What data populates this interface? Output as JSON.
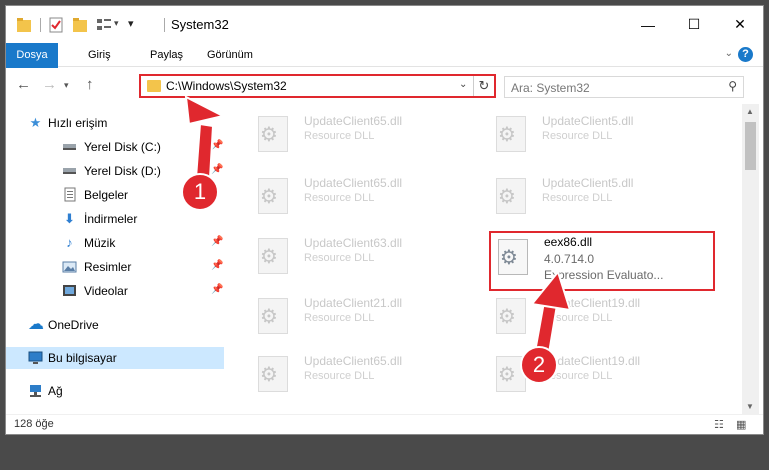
{
  "window": {
    "title": "System32",
    "controls": {
      "minimize": "—",
      "maximize": "☐",
      "close": "✕"
    }
  },
  "ribbon": {
    "tabs": [
      "Dosya",
      "Giriş",
      "Paylaş",
      "Görünüm"
    ],
    "help": "?"
  },
  "address_bar": {
    "path": "C:\\Windows\\System32",
    "search_placeholder": "Ara: System32"
  },
  "nav_pane": {
    "items": [
      {
        "label": "Hızlı erişim",
        "icon": "star-icon"
      },
      {
        "label": "Yerel Disk (C:)",
        "icon": "drive-icon"
      },
      {
        "label": "Yerel Disk (D:)",
        "icon": "drive-icon"
      },
      {
        "label": "Belgeler",
        "icon": "documents-icon"
      },
      {
        "label": "İndirmeler",
        "icon": "download-icon"
      },
      {
        "label": "Müzik",
        "icon": "music-icon"
      },
      {
        "label": "Resimler",
        "icon": "pictures-icon"
      },
      {
        "label": "Videolar",
        "icon": "videos-icon"
      },
      {
        "label": "OneDrive",
        "icon": "cloud-icon"
      },
      {
        "label": "Bu bilgisayar",
        "icon": "computer-icon"
      },
      {
        "label": "Ağ",
        "icon": "network-icon"
      }
    ]
  },
  "files": {
    "left_column": [
      {
        "name": "UpdateClient65.dll",
        "type": "Resource DLL"
      },
      {
        "name": "UpdateClient65.dll",
        "type": "Resource DLL"
      },
      {
        "name": "UpdateClient63.dll",
        "type": "Resource DLL"
      },
      {
        "name": "UpdateClient21.dll",
        "type": "Resource DLL"
      },
      {
        "name": "UpdateClient65.dll",
        "type": "Resource DLL"
      }
    ],
    "right_column": [
      {
        "name": "UpdateClient5.dll",
        "type": "Resource DLL"
      },
      {
        "name": "UpdateClient5.dll",
        "type": "Resource DLL"
      },
      {
        "name": "UpdateClient19.dll",
        "type": "Resource DLL"
      },
      {
        "name": "UpdateClient19.dll",
        "type": "Resource DLL"
      }
    ],
    "highlighted": {
      "name": "eex86.dll",
      "version": "4.0.714.0",
      "type": "Expression Evaluato..."
    }
  },
  "status_bar": {
    "item_count": "128 öğe"
  },
  "callouts": [
    "1",
    "2"
  ],
  "colors": {
    "accent": "#1979ca",
    "highlight": "#e0282e",
    "folder": "#f3c44b"
  }
}
